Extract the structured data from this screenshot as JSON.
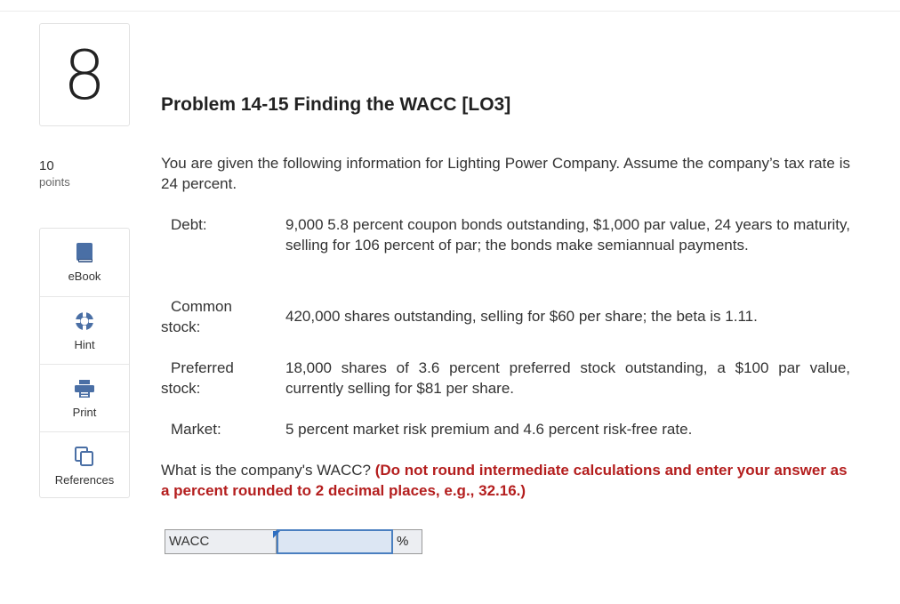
{
  "question": {
    "number": "8",
    "points_value": "10",
    "points_label": "points",
    "title": "Problem 14-15 Finding the WACC [LO3]",
    "intro": "You are given the following information for Lighting Power Company. Assume the company’s tax rate is 24 percent.",
    "rows": [
      {
        "label_1": "Debt:",
        "label_2": "",
        "value": "9,000 5.8 percent coupon bonds outstanding, $1,000 par value, 24 years to maturity, selling for 106 percent of par; the bonds make semiannual payments."
      },
      {
        "label_1": "Common",
        "label_2": "stock:",
        "value": "420,000 shares outstanding, selling for $60 per share; the beta is 1.11."
      },
      {
        "label_1": "Preferred",
        "label_2": "stock:",
        "value": "18,000 shares of 3.6 percent preferred stock outstanding, a $100 par value, currently selling for $81 per share."
      },
      {
        "label_1": "Market:",
        "label_2": "",
        "value": "5 percent market risk premium and 4.6 percent risk-free rate."
      }
    ],
    "prompt": "What is the company's WACC?",
    "instruction": "(Do not round intermediate calculations and enter your answer as a percent rounded to 2 decimal places, e.g., 32.16.)",
    "answer": {
      "label": "WACC",
      "value": "",
      "unit": "%"
    }
  },
  "tools": [
    {
      "label": "eBook",
      "icon": "book-icon"
    },
    {
      "label": "Hint",
      "icon": "lifebuoy-icon"
    },
    {
      "label": "Print",
      "icon": "printer-icon"
    },
    {
      "label": "References",
      "icon": "documents-icon"
    }
  ],
  "colors": {
    "accent": "#2f6fc1",
    "instruction": "#b41e1e",
    "icon": "#4a6fa5"
  }
}
